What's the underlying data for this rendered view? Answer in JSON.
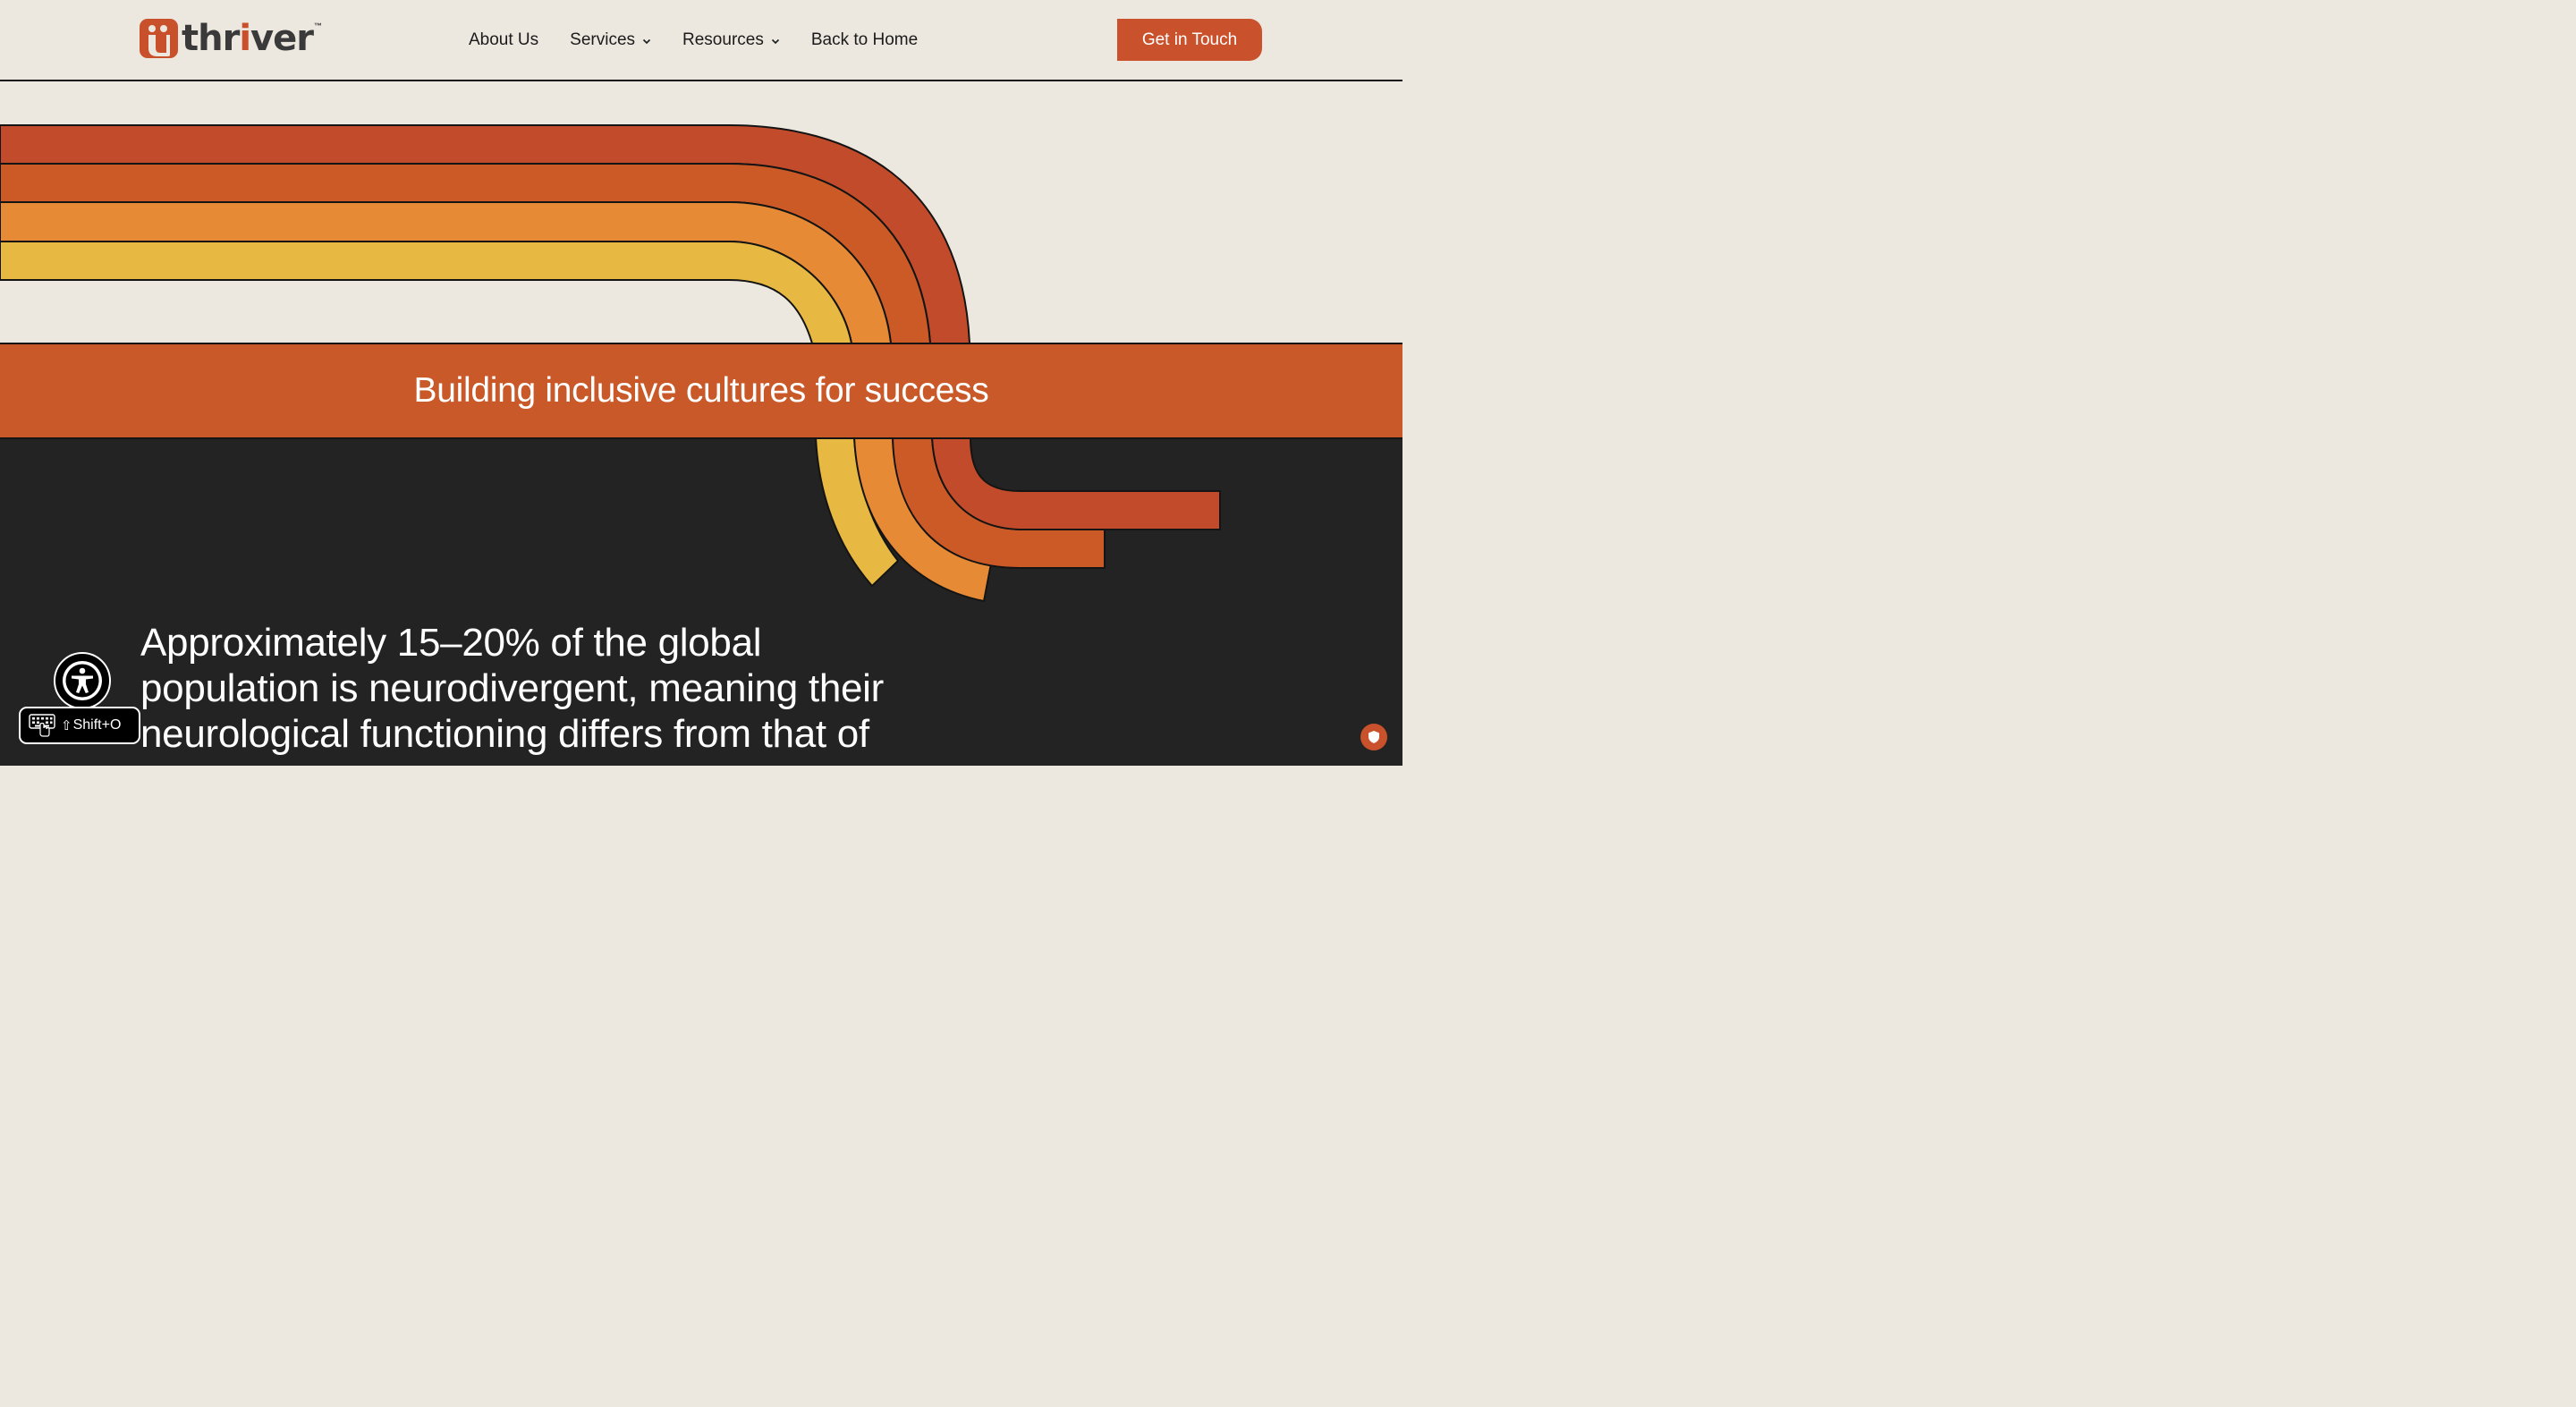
{
  "brand": {
    "logo_text_a": "thr",
    "logo_text_accent": "i",
    "logo_text_b": "ver",
    "trademark": "™",
    "primary_color": "#c9512c"
  },
  "nav": {
    "items": [
      {
        "label": "About Us",
        "has_dropdown": false
      },
      {
        "label": "Services",
        "has_dropdown": true
      },
      {
        "label": "Resources",
        "has_dropdown": true
      },
      {
        "label": "Back to Home",
        "has_dropdown": false
      }
    ],
    "cta_label": "Get in Touch"
  },
  "hero": {
    "banner_text": "Building inclusive cultures for success",
    "stripe_colors": [
      "#c24b2b",
      "#cc5a27",
      "#e68a36",
      "#e8b942"
    ]
  },
  "stat": {
    "lines": [
      "Approximately 15–20% of the global",
      "population is neurodivergent, meaning their",
      "neurological functioning differs from that of"
    ]
  },
  "accessibility": {
    "shortcut_label": "Shift+O"
  }
}
